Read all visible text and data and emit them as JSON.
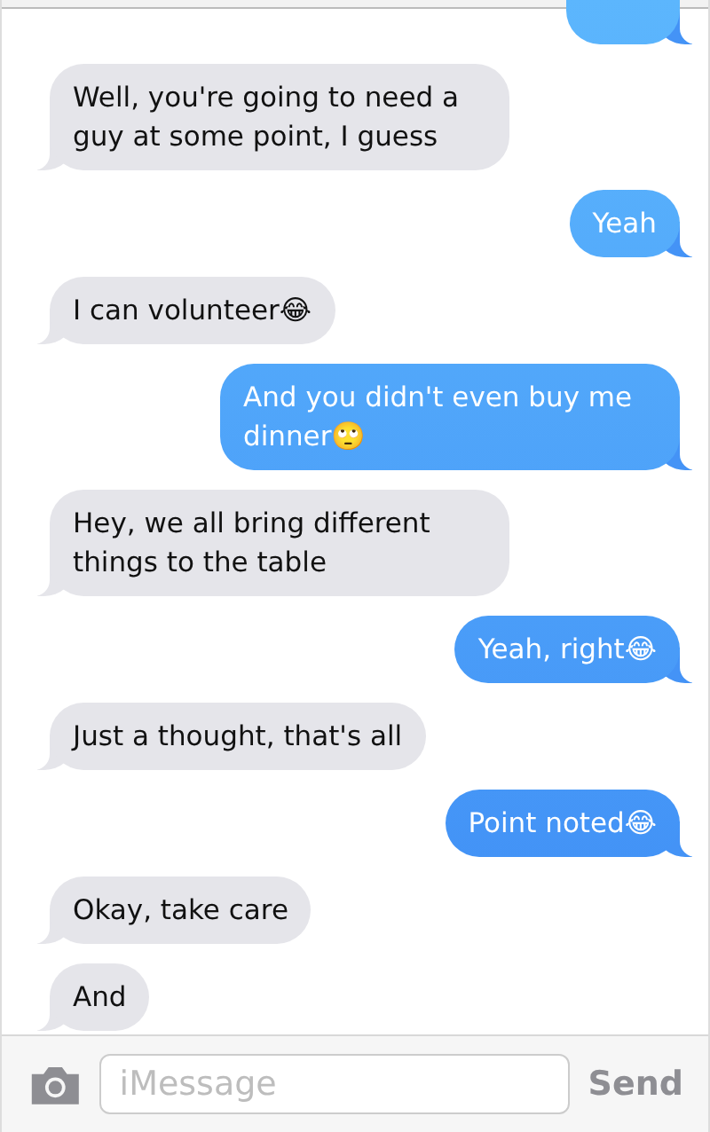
{
  "messages": [
    {
      "kind": "cut"
    },
    {
      "kind": "received",
      "text": "Well, you're going to need a guy at some point, I guess"
    },
    {
      "kind": "sent",
      "text": "Yeah"
    },
    {
      "kind": "received",
      "text": "I can volunteer😂"
    },
    {
      "kind": "sent",
      "text": "And you didn't even buy me dinner🙄"
    },
    {
      "kind": "received",
      "text": "Hey, we all bring different things to the table"
    },
    {
      "kind": "sent",
      "text": "Yeah, right😂"
    },
    {
      "kind": "received",
      "text": "Just a thought, that's all"
    },
    {
      "kind": "sent",
      "text": "Point noted😂"
    },
    {
      "kind": "received",
      "text": "Okay, take care"
    },
    {
      "kind": "received",
      "text": "And"
    }
  ],
  "composer": {
    "placeholder": "iMessage",
    "send": {
      "label": "Send",
      "disabled": true
    }
  }
}
